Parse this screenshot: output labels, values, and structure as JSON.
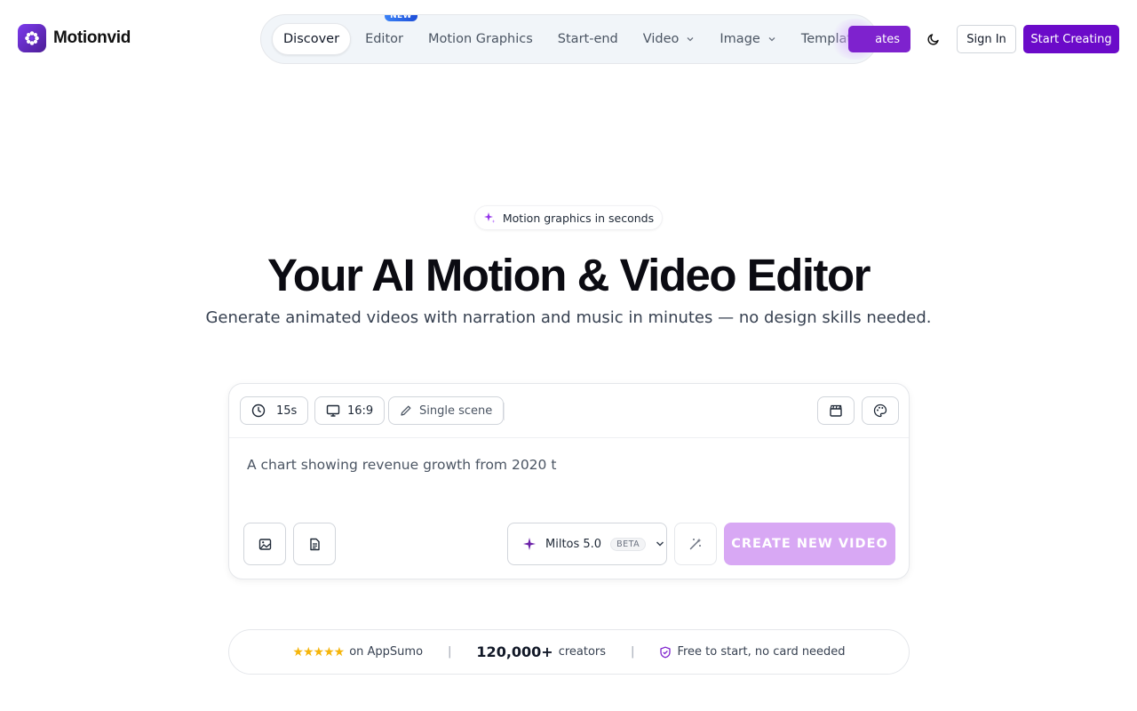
{
  "brand": {
    "name": "Motionvid"
  },
  "nav": {
    "items": [
      {
        "label": "Discover",
        "active": true
      },
      {
        "label": "Editor",
        "badge": "NEW"
      },
      {
        "label": "Motion Graphics"
      },
      {
        "label": "Start-end"
      },
      {
        "label": "Video",
        "dropdown": true
      },
      {
        "label": "Image",
        "dropdown": true
      },
      {
        "label": "Templates"
      }
    ]
  },
  "header": {
    "updates_label": "ates",
    "sign_in": "Sign In",
    "start_creating": "Start Creating"
  },
  "hero": {
    "pill": "Motion graphics in seconds",
    "title": "Your AI Motion & Video Editor",
    "subtitle": "Generate animated videos with narration and music in minutes — no design skills needed."
  },
  "composer": {
    "duration": "15s",
    "aspect": "16:9",
    "scene": "Single scene",
    "prompt_value": "A chart showing revenue growth from 2020 t",
    "model": "Miltos 5.0",
    "model_badge": "BETA",
    "create_label": "CREATE NEW VIDEO"
  },
  "trust": {
    "stars": "★★★★★",
    "appsumo": "on AppSumo",
    "count": "120,000+",
    "creators": "creators",
    "free": "Free to start, no card needed"
  },
  "colors": {
    "brand": "#6b0ac9",
    "create_disabled": "#d8a8f4",
    "star": "#f5b50a",
    "nav_badge": "#1d4ed8"
  }
}
